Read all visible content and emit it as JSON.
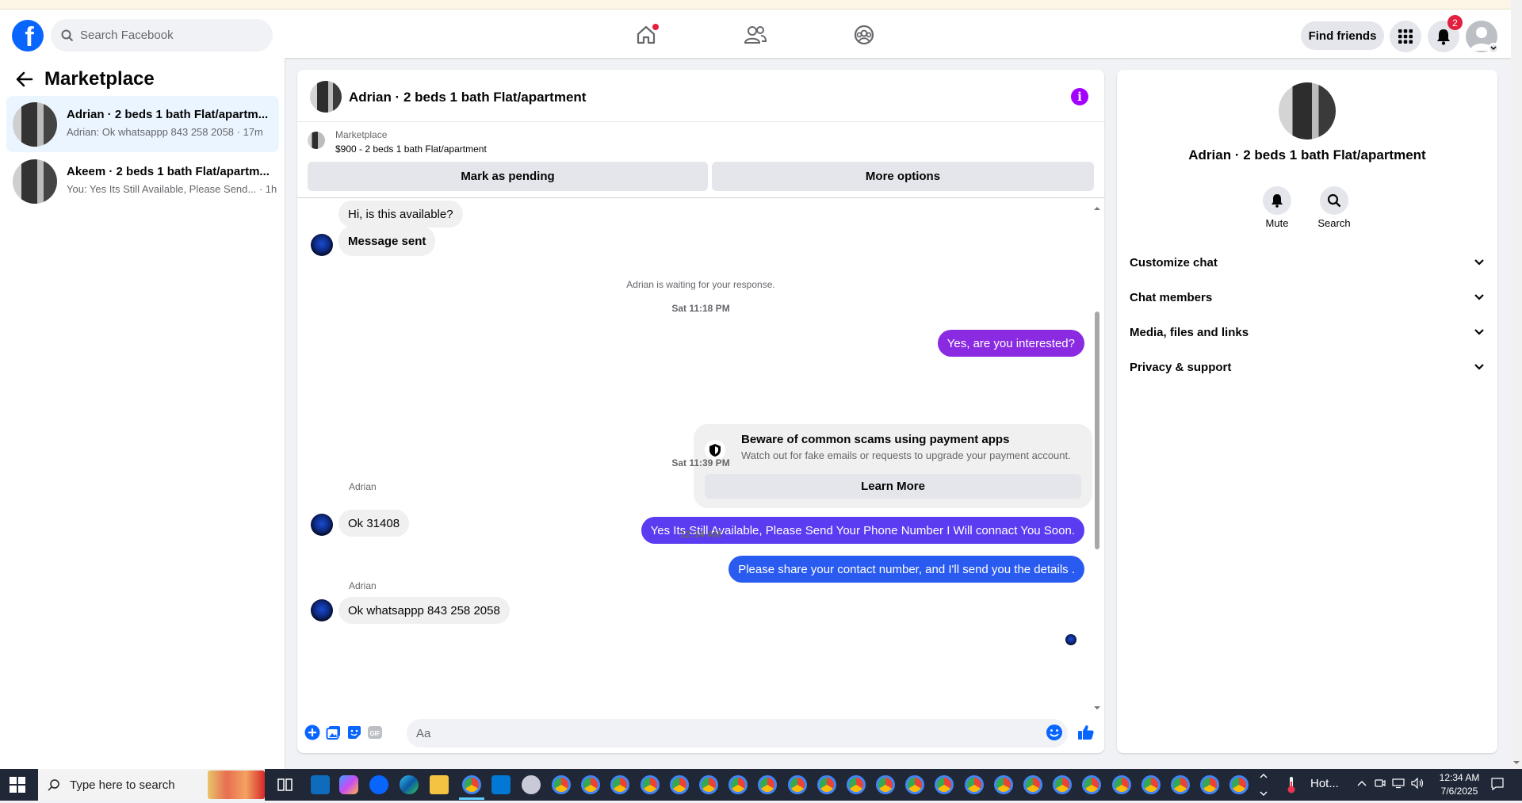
{
  "header": {
    "search_placeholder": "Search Facebook",
    "find_friends": "Find friends",
    "notification_count": "2",
    "brand_color": "#0866ff"
  },
  "sidebar": {
    "title": "Marketplace",
    "conversations": [
      {
        "title": "Adrian · 2 beds 1 bath Flat/apartm...",
        "subtitle": "Adrian: Ok whatsappp 843 258 2058 · 17m"
      },
      {
        "title": "Akeem · 2 beds 1 bath Flat/apartm...",
        "subtitle": "You: Yes Its Still Available, Please Send... · 1h"
      }
    ]
  },
  "chat": {
    "title": "Adrian · 2 beds 1 bath Flat/apartment",
    "marketplace_label": "Marketplace",
    "listing": "$900 - 2 beds 1 bath Flat/apartment",
    "mark_pending": "Mark as pending",
    "more_options": "More options",
    "messages": {
      "m1": "Hi, is this available?",
      "m2": "Message sent",
      "waiting": "Adrian is waiting for your response.",
      "ts1": "Sat 11:18 PM",
      "out1": "Yes, are you interested?",
      "scam_title": "Beware of common scams using payment apps",
      "scam_sub": "Watch out for fake emails or requests to upgrade your payment account.",
      "learn_more": "Learn More",
      "out2": "Yes Its Still Available, Please Send Your Phone Number I Will connact You Soon.",
      "ts2": "Sat 11:39 PM",
      "sender1": "Adrian",
      "in3": "Ok 31408",
      "ts3": "12:14 AM",
      "out3": "Please share your contact number, and I'll send you the details .",
      "sender2": "Adrian",
      "in4": "Ok whatsappp 843 258 2058"
    },
    "composer_placeholder": "Aa",
    "out_colors": [
      "#8a2be2",
      "#5b3cf0",
      "#2a5bf0"
    ]
  },
  "details": {
    "name": "Adrian · 2 beds 1 bath Flat/apartment",
    "mute": "Mute",
    "search": "Search",
    "sections": [
      "Customize chat",
      "Chat members",
      "Media, files and links",
      "Privacy & support"
    ]
  },
  "taskbar": {
    "search_placeholder": "Type here to search",
    "weather": "Hot...",
    "time": "12:34 AM",
    "date": "7/6/2025"
  }
}
